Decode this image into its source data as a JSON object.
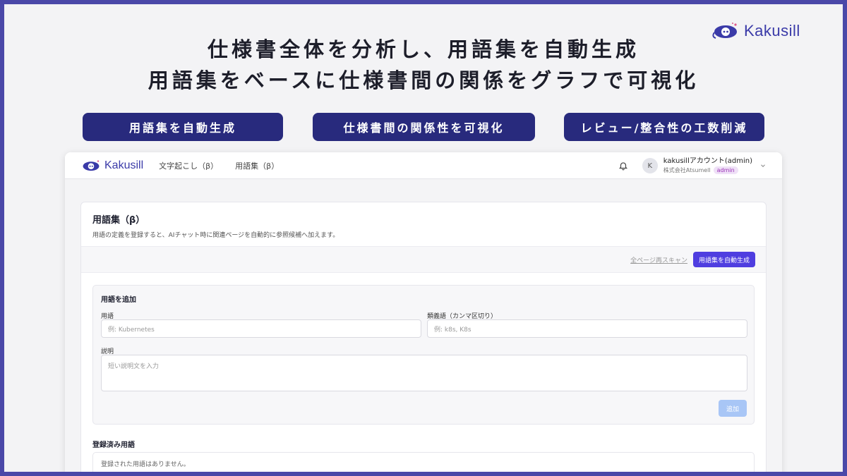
{
  "brand": {
    "name": "Kakusill"
  },
  "headline": {
    "line1": "仕様書全体を分析し、用語集を自動生成",
    "line2": "用語集をベースに仕様書間の関係をグラフで可視化"
  },
  "features": [
    {
      "label": "用語集を自動生成"
    },
    {
      "label": "仕様書間の関係性を可視化"
    },
    {
      "label": "レビュー/整合性の工数削減"
    }
  ],
  "app": {
    "logo_text": "Kakusill",
    "nav": [
      {
        "label": "文字起こし（β）"
      },
      {
        "label": "用語集（β）"
      }
    ],
    "account": {
      "avatar_initial": "K",
      "name": "kakusillアカウント(admin)",
      "org": "株式会社Atsumell",
      "role": "admin"
    },
    "glossary": {
      "title": "用語集（β）",
      "description": "用語の定義を登録すると、AIチャット時に関連ページを自動的に参照候補へ加えます。",
      "rescan_label": "全ページ再スキャン",
      "autogen_label": "用語集を自動生成",
      "add_section": {
        "title": "用語を追加",
        "term_label": "用語",
        "term_placeholder": "例: Kubernetes",
        "synonym_label": "類義語（カンマ区切り）",
        "synonym_placeholder": "例: k8s, K8s",
        "desc_label": "説明",
        "desc_placeholder": "短い説明文を入力",
        "add_button": "追加"
      },
      "registered": {
        "title": "登録済み用語",
        "empty_text": "登録された用語はありません。"
      }
    }
  },
  "colors": {
    "frame": "#4a48a8",
    "pill": "#282a7d",
    "primary": "#4f3ee0",
    "brand_text": "#3a3aa8",
    "disabled_button": "#a8c6f6"
  }
}
